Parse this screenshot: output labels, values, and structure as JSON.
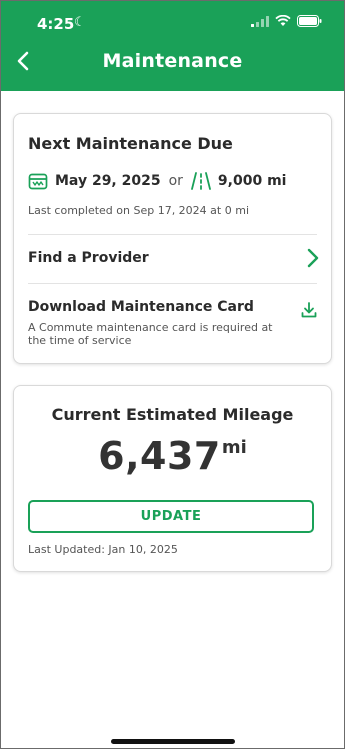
{
  "status_bar": {
    "time": "4:25",
    "moon_glyph": "☾",
    "icons": [
      "cellular-signal-icon",
      "wifi-icon",
      "battery-icon"
    ]
  },
  "header": {
    "title": "Maintenance",
    "background_color": "#1aa158"
  },
  "maintenance_card": {
    "title": "Next Maintenance Due",
    "due_date": "May 29, 2025",
    "or_text": "or",
    "due_mileage": "9,000 mi",
    "last_completed": "Last completed on Sep 17, 2024 at 0 mi",
    "find_provider_label": "Find a Provider",
    "download_label": "Download Maintenance Card",
    "download_note": "A Commute maintenance card is required at the time of service"
  },
  "mileage_card": {
    "title": "Current Estimated Mileage",
    "value": "6,437",
    "unit": "mi",
    "update_button": "UPDATE",
    "last_updated": "Last Updated: Jan 10, 2025"
  },
  "accent_color": "#1aa158"
}
